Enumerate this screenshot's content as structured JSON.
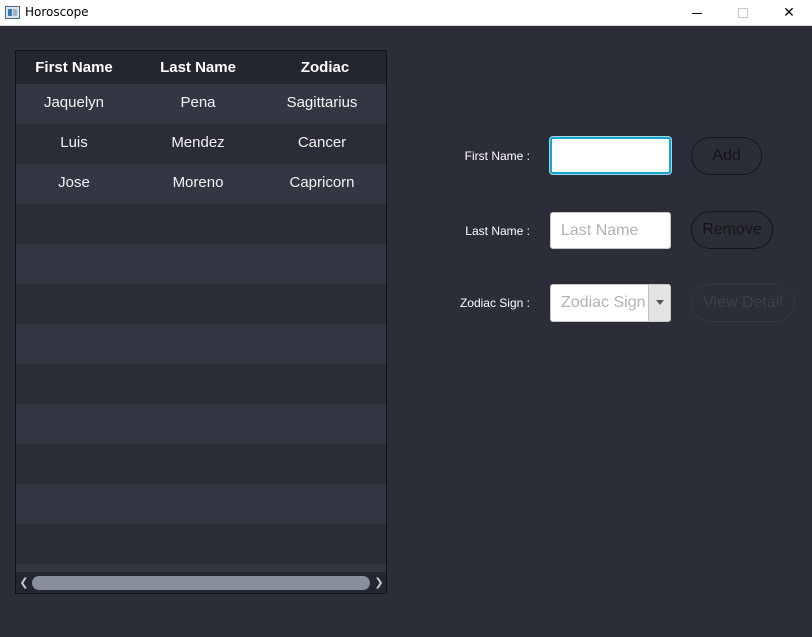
{
  "window": {
    "title": "Horoscope",
    "controls": [
      "minimize",
      "maximize",
      "close"
    ]
  },
  "table": {
    "columns": [
      "First Name",
      "Last Name",
      "Zodiac"
    ],
    "rows": [
      [
        "Jaquelyn",
        "Pena",
        "Sagittarius"
      ],
      [
        "Luis",
        "Mendez",
        "Cancer"
      ],
      [
        "Jose",
        "Moreno",
        "Capricorn"
      ]
    ]
  },
  "form": {
    "first_name_label": "First Name :",
    "first_name_value": "",
    "last_name_label": "Last Name :",
    "last_name_placeholder": "Last Name",
    "zodiac_label": "Zodiac Sign :",
    "zodiac_placeholder": "Zodiac Sign"
  },
  "buttons": {
    "add": "Add",
    "remove": "Remove",
    "view_detail": "View Detail"
  },
  "colors": {
    "background": "#2b2e38",
    "table_bg": "#23262e",
    "row_odd": "#333744",
    "row_even": "#2a2d37",
    "focus": "#16a3cc"
  }
}
